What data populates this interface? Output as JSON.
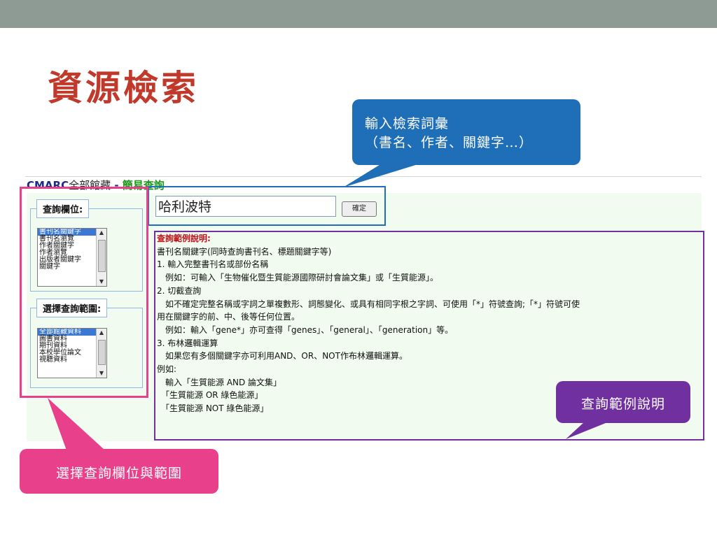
{
  "slide": {
    "title": "資源檢索"
  },
  "screenshot": {
    "header_prefix": "CMARC",
    "header_scope": "全部館藏",
    "header_sep": " - ",
    "header_mode": "簡易查詢",
    "field_legend": "查詢欄位:",
    "field_options": [
      "書刊名關鍵字",
      "書刊名瀏覽",
      "作者關鍵字",
      "作者瀏覽",
      "出版者關鍵字",
      "關鍵字"
    ],
    "scope_legend": "選擇查詢範圍:",
    "scope_options": [
      "全部館藏資料",
      "圖書資料",
      "期刊資料",
      "本校學位論文",
      "視聽資料"
    ],
    "search_value": "哈利波特",
    "confirm_label": "確定",
    "help_lines": [
      "查詢範例說明:",
      "書刊名關鍵字(同時查詢書刊名、標題關鍵字等)",
      "1. 輸入完整書刊名或部份名稱",
      "　例如：可輸入「生物催化暨生質能源國際研討會論文集」或「生質能源」。",
      "2. 切截查詢",
      "　如不確定完整名稱或字詞之單複數形、詞態變化、或具有相同字根之字詞、可使用「*」符號查詢;「*」符號可使",
      "用在關鍵字的前、中、後等任何位置。",
      "　例如：輸入「gene*」亦可查得「genes」、「general」、「generation」等。",
      "3. 布林邏輯運算",
      "　如果您有多個關鍵字亦可利用AND、OR、NOT作布林邏輯運算。",
      "例如:",
      "　輸入「生質能源 AND 論文集」",
      "　「生質能源 OR 綠色能源」",
      "　「生質能源 NOT 綠色能源」"
    ]
  },
  "callouts": {
    "blue_line1": "輸入檢索詞彙",
    "blue_line2": "（書名、作者、關鍵字…）",
    "purple": "查詢範例說明",
    "pink": "選擇查詢欄位與範圍"
  },
  "colors": {
    "title": "#c0392b",
    "blue": "#1f6fb8",
    "purple": "#7030a0",
    "pink": "#e8408a",
    "panel_bg": "#f1fbef"
  }
}
